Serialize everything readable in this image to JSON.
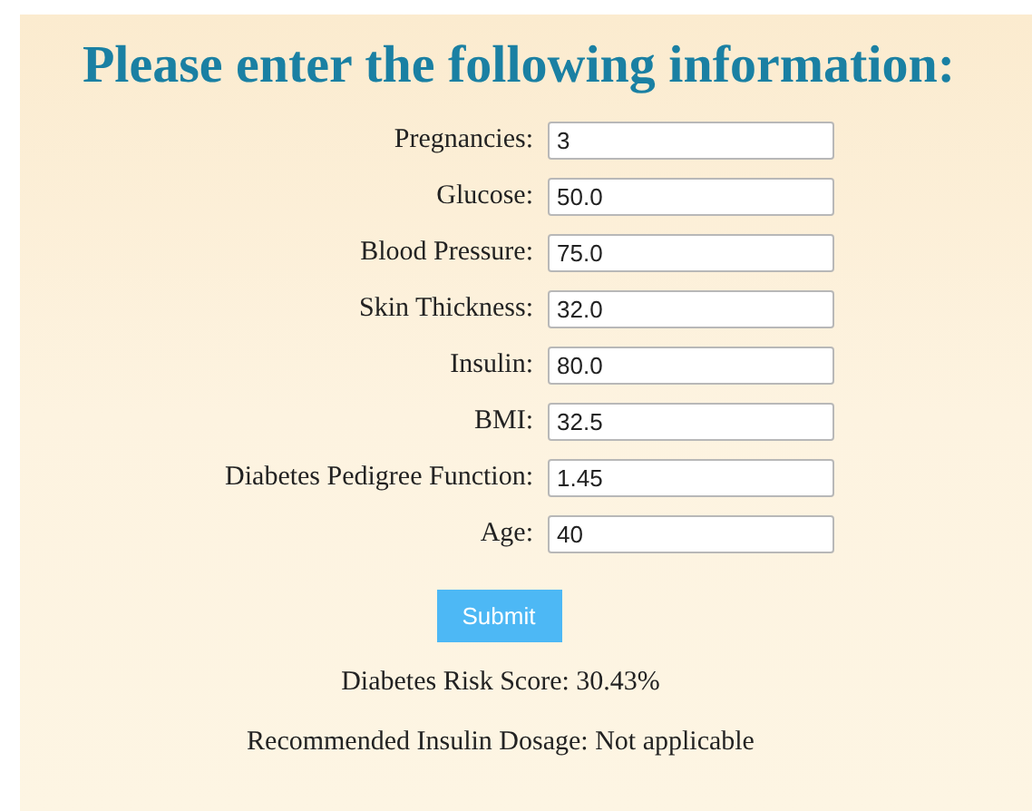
{
  "heading": "Please enter the following information:",
  "fields": [
    {
      "label": "Pregnancies:",
      "value": "3"
    },
    {
      "label": "Glucose:",
      "value": "50.0"
    },
    {
      "label": "Blood Pressure:",
      "value": "75.0"
    },
    {
      "label": "Skin Thickness:",
      "value": "32.0"
    },
    {
      "label": "Insulin:",
      "value": "80.0"
    },
    {
      "label": "BMI:",
      "value": "32.5"
    },
    {
      "label": "Diabetes Pedigree Function:",
      "value": "1.45"
    },
    {
      "label": "Age:",
      "value": "40"
    }
  ],
  "submit_button": "Submit",
  "results": [
    "Diabetes Risk Score: 30.43%",
    "Recommended Insulin Dosage: Not applicable"
  ]
}
